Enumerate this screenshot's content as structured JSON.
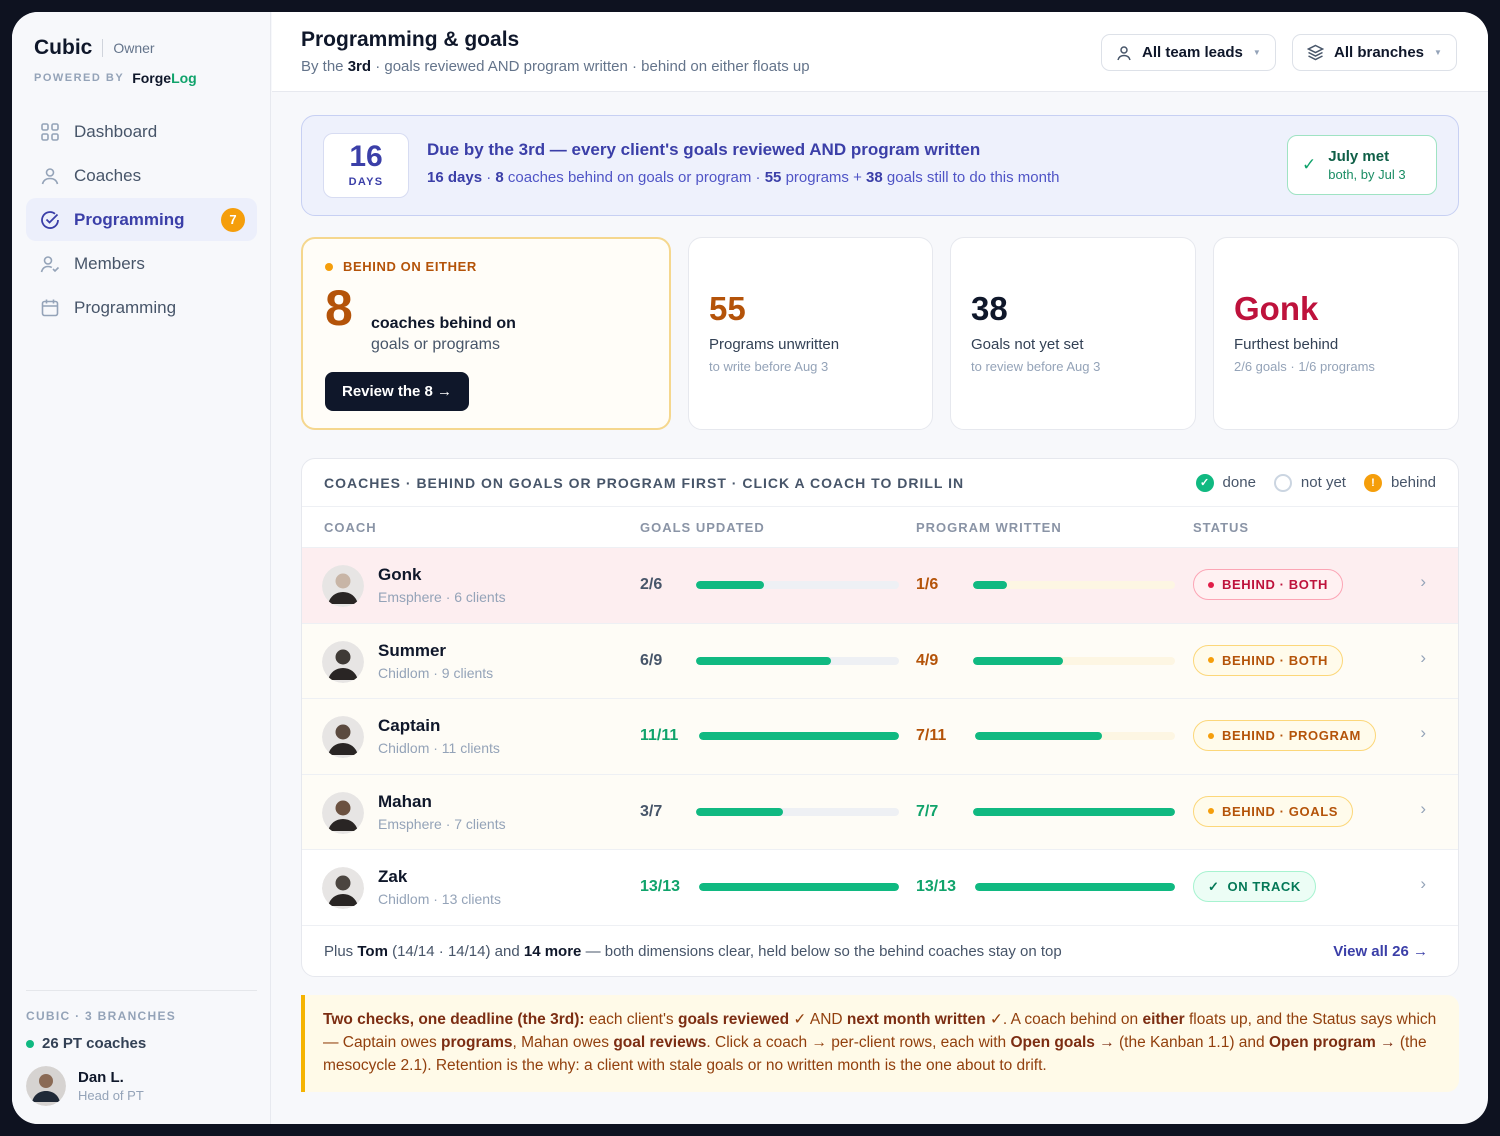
{
  "app": {
    "name": "Cubic",
    "role": "Owner",
    "powered_by": "POWERED BY",
    "forge_a": "Forge",
    "forge_b": "Log"
  },
  "nav": [
    {
      "label": "Dashboard",
      "icon": "grid-icon"
    },
    {
      "label": "Coaches",
      "icon": "person-icon"
    },
    {
      "label": "Programming",
      "icon": "check-circle-icon",
      "badge": "7",
      "active": true
    },
    {
      "label": "Members",
      "icon": "person-check-icon"
    },
    {
      "label": "Programming",
      "icon": "calendar-icon"
    }
  ],
  "sidebar_footer": {
    "meta": "CUBIC · 3 BRANCHES",
    "coaches": "26 PT coaches",
    "user_name": "Dan L.",
    "user_role": "Head of PT"
  },
  "header": {
    "title": "Programming & goals",
    "sub_a": "By the ",
    "sub_b": "3rd",
    "sub_c": " · goals reviewed AND program written · behind on either floats up",
    "filter_leads": "All team leads",
    "filter_branches": "All branches"
  },
  "banner": {
    "days_num": "16",
    "days_label": "DAYS",
    "title": "Due by the 3rd — every client's goals reviewed AND program written",
    "s1": "16 days",
    "s2": " · ",
    "s3": "8",
    "s4": " coaches behind on goals or program · ",
    "s5": "55",
    "s6": " programs + ",
    "s7": "38",
    "s8": " goals still to do this month",
    "met_title": "July met",
    "met_sub": "both, by Jul 3"
  },
  "hero": {
    "tag": "BEHIND ON EITHER",
    "num": "8",
    "line1": "coaches behind on",
    "line2": "goals or programs",
    "button": "Review the 8 →"
  },
  "stats": [
    {
      "num": "55",
      "l1": "Programs unwritten",
      "l2": "to write before Aug 3",
      "color": "#b45309"
    },
    {
      "num": "38",
      "l1": "Goals not yet set",
      "l2": "to review before Aug 3",
      "color": "#0f172a"
    },
    {
      "num": "Gonk",
      "l1": "Furthest behind",
      "l2": "2/6 goals · 1/6 programs",
      "color": "#be123c"
    }
  ],
  "table": {
    "caption": "COACHES · BEHIND ON GOALS OR PROGRAM FIRST · CLICK A COACH TO DRILL IN",
    "legend": {
      "done": "done",
      "not_yet": "not yet",
      "behind": "behind"
    },
    "columns": {
      "coach": "COACH",
      "goals": "GOALS UPDATED",
      "program": "PROGRAM WRITTEN",
      "status": "STATUS"
    },
    "rows": [
      {
        "name": "Gonk",
        "meta": "Emsphere · 6 clients",
        "goals": "2/6",
        "goals_frac": 0.333,
        "program": "1/6",
        "program_frac": 0.167,
        "status": "BEHIND · BOTH",
        "tone": "red"
      },
      {
        "name": "Summer",
        "meta": "Chidlom · 9 clients",
        "goals": "6/9",
        "goals_frac": 0.667,
        "program": "4/9",
        "program_frac": 0.444,
        "status": "BEHIND · BOTH",
        "tone": "amber"
      },
      {
        "name": "Captain",
        "meta": "Chidlom · 11 clients",
        "goals": "11/11",
        "goals_frac": 1,
        "program": "7/11",
        "program_frac": 0.636,
        "status": "BEHIND · PROGRAM",
        "tone": "amber"
      },
      {
        "name": "Mahan",
        "meta": "Emsphere · 7 clients",
        "goals": "3/7",
        "goals_frac": 0.429,
        "program": "7/7",
        "program_frac": 1,
        "status": "BEHIND · GOALS",
        "tone": "amber"
      },
      {
        "name": "Zak",
        "meta": "Chidlom · 13 clients",
        "goals": "13/13",
        "goals_frac": 1,
        "program": "13/13",
        "program_frac": 1,
        "status": "ON TRACK",
        "tone": "green"
      }
    ],
    "footer_a": "Plus ",
    "footer_b": "Tom",
    "footer_c": " (14/14 · 14/14) and ",
    "footer_d": "14 more",
    "footer_e": " — both dimensions clear, held below so the behind coaches stay on top",
    "view_all": "View all 26 →"
  },
  "note": {
    "n1": "Two checks, one deadline (the 3rd):",
    "n2": " each client's ",
    "n3": "goals reviewed",
    "n4": " ✓ AND ",
    "n5": "next month written",
    "n6": " ✓. A coach behind on ",
    "n7": "either",
    "n8": " floats up, and the Status says which — Captain owes ",
    "n9": "programs",
    "n10": ", Mahan owes ",
    "n11": "goal reviews",
    "n12": ". Click a coach → per-client rows, each with ",
    "n13": "Open goals →",
    "n14": " (the Kanban 1.1) and ",
    "n15": "Open program →",
    "n16": " (the mesocycle 2.1). Retention is the why: a client with stale goals or no written month is the one about to drift."
  },
  "colors": {
    "accent": "#3b3fa8",
    "green": "#10b981",
    "amber": "#f59e0b",
    "red": "#e11d48"
  }
}
